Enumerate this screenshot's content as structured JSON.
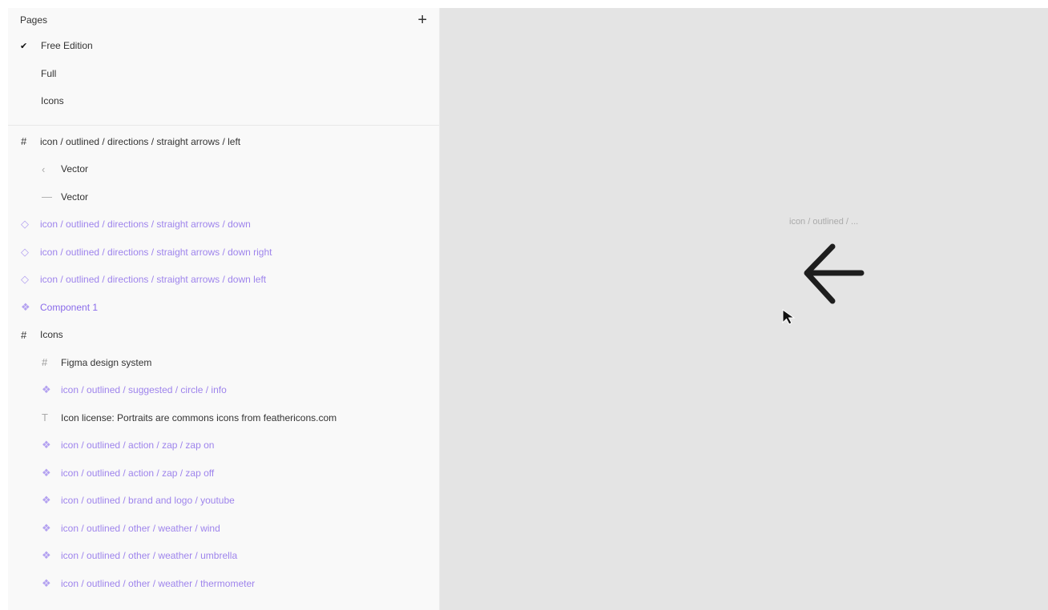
{
  "pages": {
    "title": "Pages",
    "add_label": "+",
    "items": [
      {
        "label": "Free Edition",
        "selected": true,
        "check": "✔"
      },
      {
        "label": "Full",
        "selected": false
      },
      {
        "label": "Icons",
        "selected": false
      }
    ]
  },
  "layers": [
    {
      "label": "icon / outlined / directions / straight arrows / left",
      "icon": "#",
      "icon_name": "frame-icon",
      "level": 0,
      "style": "normal"
    },
    {
      "label": "Vector",
      "icon": "‹",
      "icon_name": "vector-chevron-icon",
      "level": 1,
      "style": "normal"
    },
    {
      "label": "Vector",
      "icon": "—",
      "icon_name": "vector-line-icon",
      "level": 1,
      "style": "normal"
    },
    {
      "label": "icon / outlined / directions / straight arrows / down",
      "icon": "◇",
      "icon_name": "instance-icon",
      "level": 0,
      "style": "purple"
    },
    {
      "label": "icon / outlined / directions / straight arrows / down right",
      "icon": "◇",
      "icon_name": "instance-icon",
      "level": 0,
      "style": "purple"
    },
    {
      "label": "icon / outlined / directions / straight arrows / down left",
      "icon": "◇",
      "icon_name": "instance-icon",
      "level": 0,
      "style": "purple"
    },
    {
      "label": "Component 1",
      "icon": "❖",
      "icon_name": "component-icon",
      "level": 0,
      "style": "bold-purple"
    },
    {
      "label": "Icons",
      "icon": "#",
      "icon_name": "frame-icon",
      "level": 0,
      "style": "normal"
    },
    {
      "label": "Figma design system",
      "icon": "#",
      "icon_name": "frame-icon",
      "level": 1,
      "style": "normal"
    },
    {
      "label": "icon / outlined / suggested / circle / info",
      "icon": "❖",
      "icon_name": "component-icon",
      "level": 1,
      "style": "purple"
    },
    {
      "label": "Icon license: Portraits are commons icons from feathericons.com",
      "icon": "T",
      "icon_name": "text-icon",
      "level": 1,
      "style": "normal"
    },
    {
      "label": "icon / outlined / action / zap / zap on",
      "icon": "❖",
      "icon_name": "component-icon",
      "level": 1,
      "style": "purple"
    },
    {
      "label": "icon / outlined / action / zap / zap off",
      "icon": "❖",
      "icon_name": "component-icon",
      "level": 1,
      "style": "purple"
    },
    {
      "label": "icon / outlined / brand and logo / youtube",
      "icon": "❖",
      "icon_name": "component-icon",
      "level": 1,
      "style": "purple"
    },
    {
      "label": "icon / outlined / other / weather / wind",
      "icon": "❖",
      "icon_name": "component-icon",
      "level": 1,
      "style": "purple"
    },
    {
      "label": "icon / outlined / other / weather / umbrella",
      "icon": "❖",
      "icon_name": "component-icon",
      "level": 1,
      "style": "purple"
    },
    {
      "label": "icon / outlined / other / weather / thermometer",
      "icon": "❖",
      "icon_name": "component-icon",
      "level": 1,
      "style": "purple"
    }
  ],
  "canvas": {
    "frame_label": "icon / outlined / ...",
    "background": "#e4e4e4",
    "arrow_color": "#1e1e1e",
    "arrow_icon": "arrow-left-icon"
  },
  "colors": {
    "instance_purple": "#9e84ec",
    "component_purple": "#8a6bea"
  }
}
